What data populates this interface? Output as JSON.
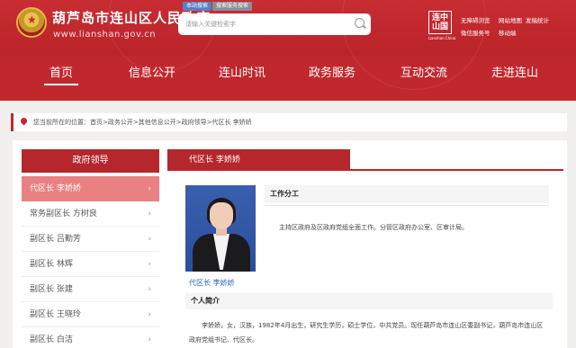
{
  "header": {
    "site_name": "葫芦岛市连山区人民政府",
    "site_url": "www.lianshan.gov.cn",
    "search_tabs": [
      "本站搜索",
      "搜索服务搜索"
    ],
    "search_placeholder": "请输入关键检索字",
    "seal_text": "连中\n山国",
    "seal_subtext": "Lianshan China",
    "quick_links": [
      "无障碍浏览",
      "网站地图",
      "发稿统计",
      "微信服务号",
      "移动端"
    ]
  },
  "nav": {
    "items": [
      "首页",
      "信息公开",
      "连山时讯",
      "政务服务",
      "互动交流",
      "走进连山"
    ],
    "active": "首页"
  },
  "breadcrumb": {
    "text": "您当前所在的位置：首页>政务公开>其他信息公开>政府领导>代区长 李娇娇"
  },
  "sidebar": {
    "title": "政府领导",
    "items": [
      {
        "label": "代区长 李娇娇",
        "active": true
      },
      {
        "label": "常务副区长 方树良",
        "active": false
      },
      {
        "label": "副区长 吕勤芳",
        "active": false
      },
      {
        "label": "副区长 林辉",
        "active": false
      },
      {
        "label": "副区长 张建",
        "active": false
      },
      {
        "label": "副区长 王晓玲",
        "active": false
      },
      {
        "label": "副区长 白洁",
        "active": false
      }
    ]
  },
  "main": {
    "header": "代区长 李娇娇",
    "photo_caption": "代区长 李娇娇",
    "duty_title": "工作分工",
    "duty_text": "主持区政府及区政府党组全面工作。分管区政府办公室、区审计局。",
    "bio_title": "个人简介",
    "bio_text": "李娇娇，女，汉族，1982年4月出生，研究生学历，硕士学位，中共党员。现任葫芦岛市连山区委副书记，葫芦岛市连山区政府党组书记、代区长。"
  },
  "colors": {
    "brand_red": "#c1282e",
    "active_item": "#e98081",
    "link_blue": "#2b62b8"
  }
}
